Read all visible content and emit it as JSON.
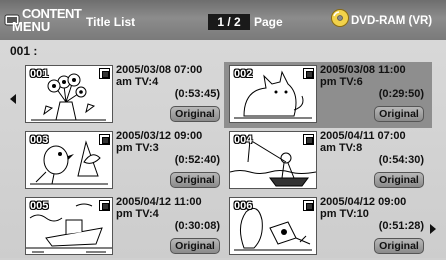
{
  "header": {
    "logo_line1": "CONTENT",
    "logo_line2": "MENU",
    "title": "Title List",
    "page_indicator": "1 / 2",
    "page_label": "Page",
    "disc_label": "DVD-RAM (VR)"
  },
  "selected_index": "001 :",
  "titles": [
    {
      "num": "001",
      "line1": "2005/03/08 07:00",
      "line2": "am  TV:4",
      "duration": "(0:53:45)",
      "tag": "Original",
      "selected": false
    },
    {
      "num": "002",
      "line1": "2005/03/08 11:00",
      "line2": "pm  TV:6",
      "duration": "(0:29:50)",
      "tag": "Original",
      "selected": true
    },
    {
      "num": "003",
      "line1": "2005/03/12 09:00",
      "line2": "pm  TV:3",
      "duration": "(0:52:40)",
      "tag": "Original",
      "selected": false
    },
    {
      "num": "004",
      "line1": "2005/04/11 07:00",
      "line2": "am  TV:8",
      "duration": "(0:54:30)",
      "tag": "Original",
      "selected": false
    },
    {
      "num": "005",
      "line1": "2005/04/12 11:00",
      "line2": "pm  TV:4",
      "duration": "(0:30:08)",
      "tag": "Original",
      "selected": false
    },
    {
      "num": "006",
      "line1": "2005/04/12 09:00",
      "line2": "pm  TV:10",
      "duration": "(0:51:28)",
      "tag": "Original",
      "selected": false
    }
  ],
  "colors": {
    "header_bg": "#7a7a7a",
    "page_box_bg": "#1a1a1a",
    "selected_bg": "#8e8e8e"
  }
}
